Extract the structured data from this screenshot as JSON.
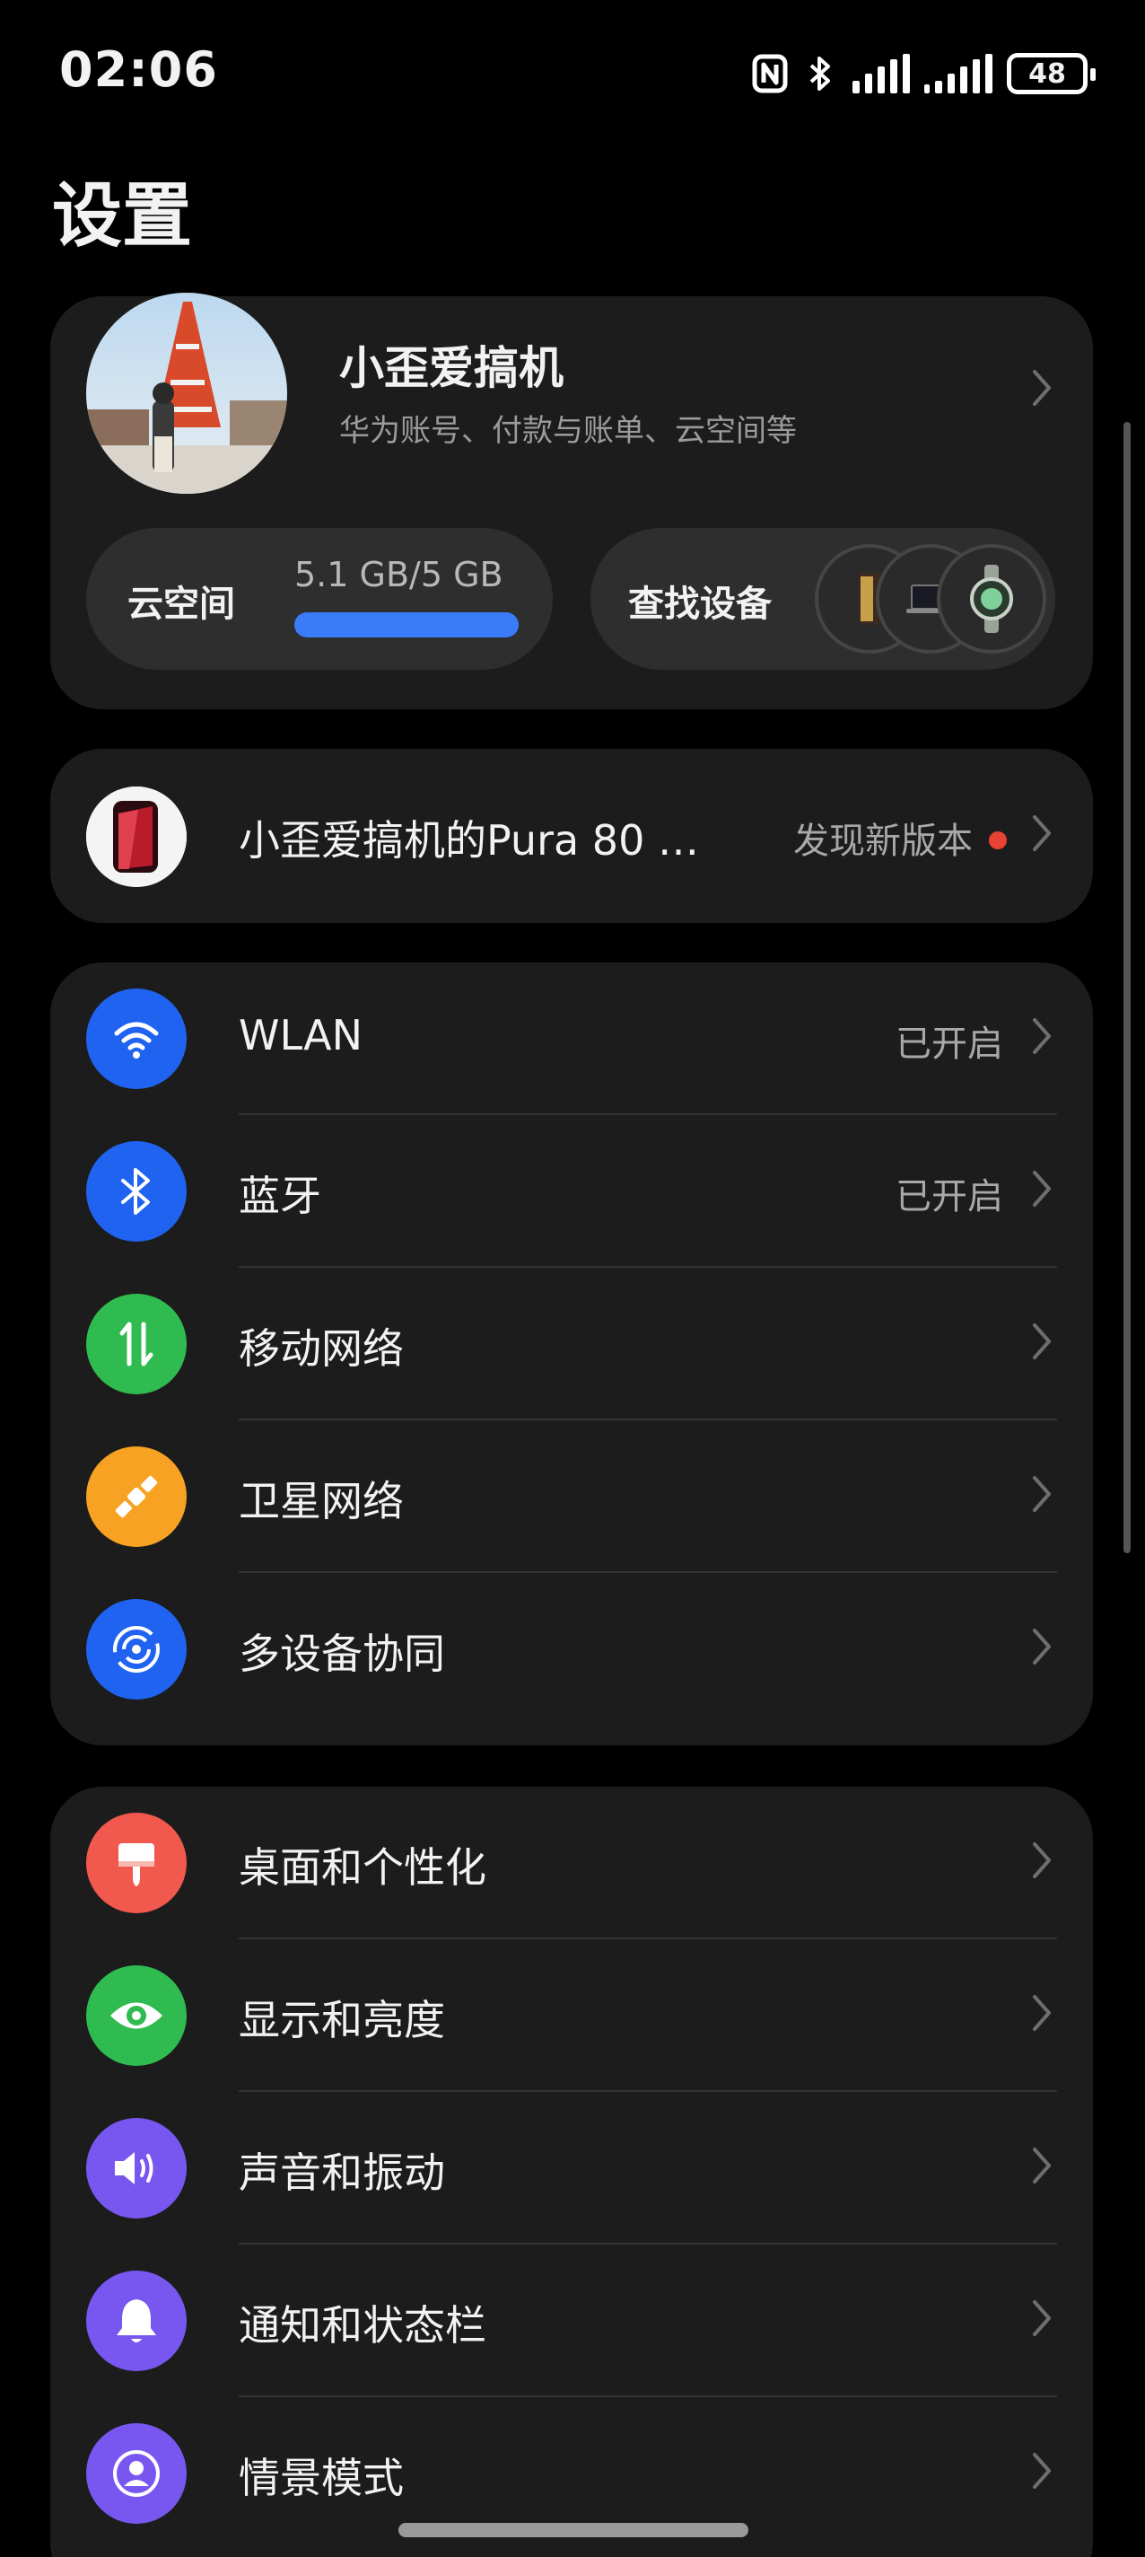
{
  "status_bar": {
    "time": "02:06",
    "battery": "48",
    "icons": [
      "nfc-icon",
      "bluetooth-icon",
      "signal-icon",
      "signal-icon"
    ]
  },
  "page_title": "设置",
  "account": {
    "name": "小歪爱搞机",
    "subtitle": "华为账号、付款与账单、云空间等",
    "cloud": {
      "label": "云空间",
      "usage": "5.1 GB/5 GB",
      "used_fraction": 1.0,
      "bar_color": "#3a7bf7"
    },
    "find_device": {
      "label": "查找设备"
    }
  },
  "device_update": {
    "name": "小歪爱搞机的Pura 80 …",
    "status": "发现新版本",
    "dot_color": "#e84235"
  },
  "network_group": [
    {
      "label": "WLAN",
      "value": "已开启",
      "icon": "wifi-icon",
      "color": "#1f63f0"
    },
    {
      "label": "蓝牙",
      "value": "已开启",
      "icon": "bluetooth-icon",
      "color": "#1f63f0"
    },
    {
      "label": "移动网络",
      "value": "",
      "icon": "mobile-data-icon",
      "color": "#2fbb50"
    },
    {
      "label": "卫星网络",
      "value": "",
      "icon": "satellite-icon",
      "color": "#f7a223"
    },
    {
      "label": "多设备协同",
      "value": "",
      "icon": "multi-device-icon",
      "color": "#1f63f0"
    }
  ],
  "display_group": [
    {
      "label": "桌面和个性化",
      "icon": "paint-brush-icon",
      "color": "#f1594e"
    },
    {
      "label": "显示和亮度",
      "icon": "eye-icon",
      "color": "#2fbb50"
    },
    {
      "label": "声音和振动",
      "icon": "speaker-icon",
      "color": "#7857f0"
    },
    {
      "label": "通知和状态栏",
      "icon": "bell-icon",
      "color": "#7857f0"
    },
    {
      "label": "情景模式",
      "icon": "profile-mode-icon",
      "color": "#7857f0"
    }
  ]
}
